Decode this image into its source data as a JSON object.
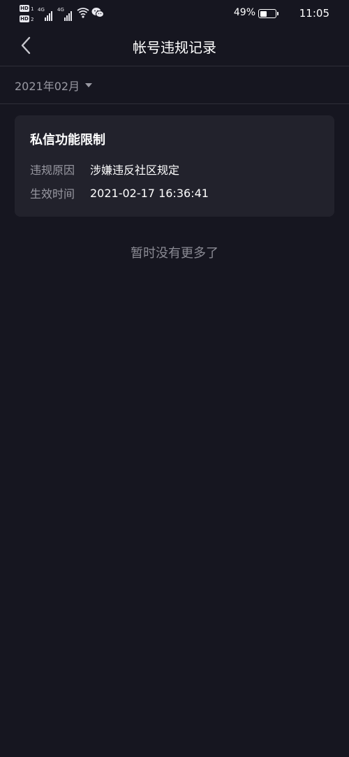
{
  "status_bar": {
    "hd_label": "HD",
    "sim1": "1",
    "sim2": "2",
    "network1": "4G",
    "network2": "4G",
    "battery_percent": "49%",
    "battery_level": 0.49,
    "time": "11:05",
    "icons": [
      "hd-icon",
      "signal-icon",
      "wifi-icon",
      "wechat-icon",
      "battery-icon"
    ]
  },
  "nav": {
    "title": "帐号违规记录",
    "back_icon": "chevron-left-icon"
  },
  "filter": {
    "month_label": "2021年02月",
    "dropdown_icon": "caret-down-icon"
  },
  "records": [
    {
      "title": "私信功能限制",
      "reason_label": "违规原因",
      "reason_value": "涉嫌违反社区规定",
      "time_label": "生效时间",
      "time_value": "2021-02-17 16:36:41"
    }
  ],
  "end_hint": "暂时没有更多了",
  "colors": {
    "background": "#161620",
    "card": "#22222c",
    "divider": "#2e2e38",
    "muted_text": "#9a9aa3",
    "primary_text": "#ffffff"
  }
}
